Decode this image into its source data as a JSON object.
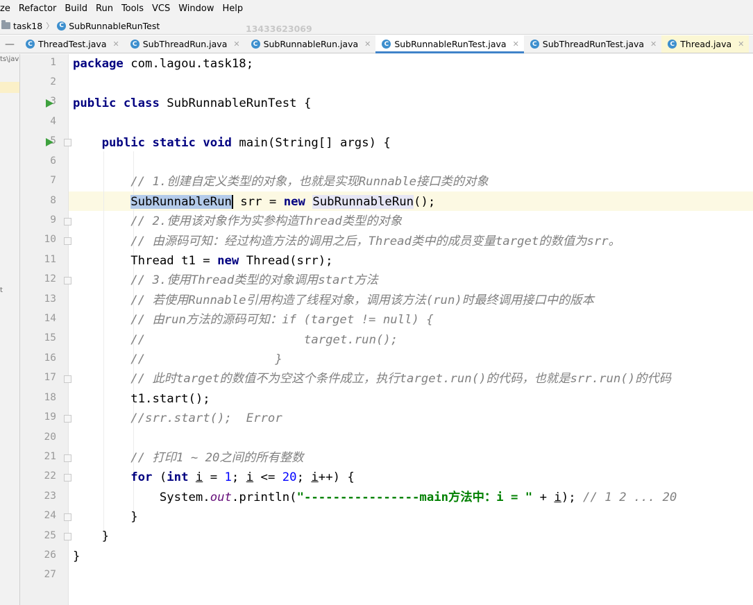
{
  "menu": [
    "ze",
    "Refactor",
    "Build",
    "Run",
    "Tools",
    "VCS",
    "Window",
    "Help"
  ],
  "breadcrumb": {
    "folder": "task18",
    "file": "SubRunnableRunTest"
  },
  "watermark": "13433623069",
  "tabs": [
    {
      "label": "ThreadTest.java",
      "state": "normal"
    },
    {
      "label": "SubThreadRun.java",
      "state": "normal"
    },
    {
      "label": "SubRunnableRun.java",
      "state": "normal"
    },
    {
      "label": "SubRunnableRunTest.java",
      "state": "active"
    },
    {
      "label": "SubThreadRunTest.java",
      "state": "normal"
    },
    {
      "label": "Thread.java",
      "state": "highlight"
    }
  ],
  "left_strip": {
    "top_text": "ts\\jav",
    "mid_text": "t"
  },
  "line_numbers": [
    "1",
    "2",
    "3",
    "4",
    "5",
    "6",
    "7",
    "8",
    "9",
    "10",
    "11",
    "12",
    "13",
    "14",
    "15",
    "16",
    "17",
    "18",
    "19",
    "20",
    "21",
    "22",
    "23",
    "24",
    "25",
    "26",
    "27"
  ],
  "code": {
    "l1_kw": "package",
    "l1_rest": " com.lagou.task18;",
    "l3_kw1": "public",
    "l3_kw2": "class",
    "l3_rest": " SubRunnableRunTest {",
    "l5_kw1": "public",
    "l5_kw2": "static",
    "l5_kw3": "void",
    "l5_rest": " main(String[] args) {",
    "l7": "// 1.创建自定义类型的对象，也就是实现Runnable接口类的对象",
    "l8_a": "SubRunnableRun",
    "l8_b": " srr = ",
    "l8_kw": "new",
    "l8_c": "SubRunnableRun",
    "l8_d": "();",
    "l9": "// 2.使用该对象作为实参构造Thread类型的对象",
    "l10": "// 由源码可知：经过构造方法的调用之后，Thread类中的成员变量target的数值为srr。",
    "l11_a": "Thread t1 = ",
    "l11_kw": "new",
    "l11_b": " Thread(srr);",
    "l12": "// 3.使用Thread类型的对象调用start方法",
    "l13": "// 若使用Runnable引用构造了线程对象，调用该方法(run)时最终调用接口中的版本",
    "l14": "// 由run方法的源码可知：if (target != null) {",
    "l15": "//                      target.run();",
    "l16": "//                  }",
    "l17": "// 此时target的数值不为空这个条件成立，执行target.run()的代码，也就是srr.run()的代码",
    "l18": "t1.start();",
    "l19": "//srr.start();  Error",
    "l21": "// 打印1 ~ 20之间的所有整数",
    "l22_kw1": "for",
    "l22_a": " (",
    "l22_kw2": "int",
    "l22_b": " ",
    "l22_i1": "i",
    "l22_c": " = ",
    "l22_n1": "1",
    "l22_d": "; ",
    "l22_i2": "i",
    "l22_e": " <= ",
    "l22_n2": "20",
    "l22_f": "; ",
    "l22_i3": "i",
    "l22_g": "++) {",
    "l23_a": "System.",
    "l23_fld": "out",
    "l23_b": ".println(",
    "l23_str": "\"----------------main方法中：i = \"",
    "l23_c": " + ",
    "l23_i": "i",
    "l23_d": "); ",
    "l23_cm": "// 1 2 ... 20",
    "l24": "}",
    "l25": "}",
    "l26": "}"
  }
}
